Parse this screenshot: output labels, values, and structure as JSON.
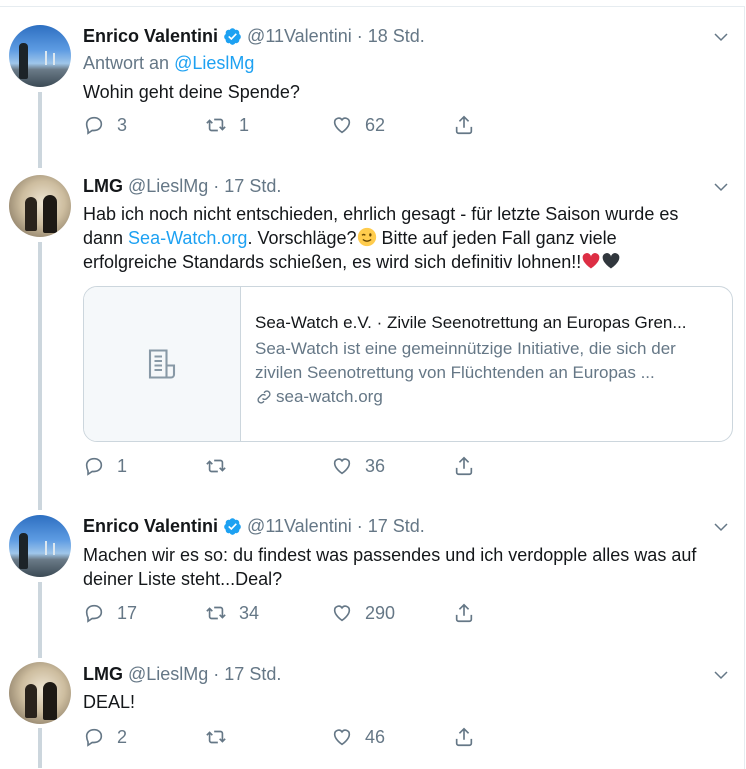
{
  "tweets": [
    {
      "name": "Enrico Valentini",
      "verified": true,
      "handle": "@11Valentini",
      "time": "18 Std.",
      "reply_prefix": "Antwort an",
      "reply_handle": "@LieslMg",
      "text": "Wohin geht deine Spende?",
      "replies": "3",
      "retweets": "1",
      "likes": "62"
    },
    {
      "name": "LMG",
      "verified": false,
      "handle": "@LieslMg",
      "time": "17 Std.",
      "text_line1": "Hab ich noch nicht entschieden, ehrlich gesagt - für letzte Saison wurde es",
      "text_line2_a": "dann ",
      "text_line2_link": "Sea-Watch.org",
      "text_line2_b": ". Vorschläge?",
      "text_line2_c": " Bitte auf jeden Fall ganz viele",
      "text_line3": "erfolgreiche Standards schießen, es wird sich definitiv lohnen!!",
      "replies": "1",
      "retweets": "",
      "likes": "36",
      "card": {
        "title": "Sea-Watch e.V. · Zivile Seenotrettung an Europas Gren...",
        "desc": "Sea-Watch ist eine gemeinnützige Initiative, die sich der zivilen Seenotrettung von Flüchtenden an Europas ...",
        "domain": "sea-watch.org"
      }
    },
    {
      "name": "Enrico Valentini",
      "verified": true,
      "handle": "@11Valentini",
      "time": "17 Std.",
      "text": "Machen wir es so: du findest was passendes und ich verdopple alles was auf deiner Liste steht...Deal?",
      "replies": "17",
      "retweets": "34",
      "likes": "290"
    },
    {
      "name": "LMG",
      "verified": false,
      "handle": "@LieslMg",
      "time": "17 Std.",
      "text": "DEAL!",
      "replies": "2",
      "retweets": "",
      "likes": "46"
    }
  ],
  "icons": {
    "reply": "reply-icon",
    "retweet": "retweet-icon",
    "like": "heart-icon",
    "share": "share-icon",
    "more": "chevron-down-icon",
    "verified": "verified-badge-icon",
    "card": "article-icon",
    "link": "link-icon"
  },
  "colors": {
    "accent": "#1da1f2",
    "muted": "#657786",
    "thread_line": "#ccd6dd",
    "heart_red": "#e0245e"
  }
}
